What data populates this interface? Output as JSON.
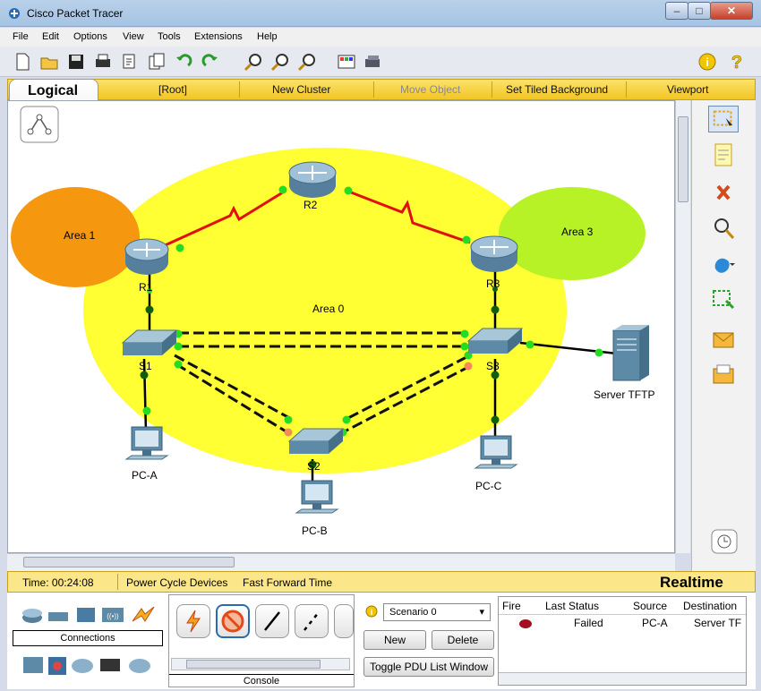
{
  "window": {
    "title": "Cisco Packet Tracer"
  },
  "menu": [
    "File",
    "Edit",
    "Options",
    "View",
    "Tools",
    "Extensions",
    "Help"
  ],
  "logical_bar": {
    "tab_label": "Logical",
    "root": "[Root]",
    "new_cluster": "New Cluster",
    "move_object": "Move Object",
    "set_tiled_background": "Set Tiled Background",
    "viewport": "Viewport"
  },
  "topology": {
    "areas": [
      "Area 0",
      "Area 1",
      "Area 3"
    ],
    "routers": [
      "R1",
      "R2",
      "R3"
    ],
    "switches": [
      "S1",
      "S2",
      "S3"
    ],
    "pcs": [
      "PC-A",
      "PC-B",
      "PC-C"
    ],
    "server": "Server TFTP"
  },
  "time_bar": {
    "time": "Time: 00:24:08",
    "power_cycle": "Power Cycle Devices",
    "fast_forward": "Fast Forward Time",
    "mode": "Realtime"
  },
  "bottom": {
    "connections_label": "Connections",
    "console_label": "Console",
    "scenario": "Scenario 0",
    "new_button": "New",
    "delete_button": "Delete",
    "toggle_button": "Toggle PDU List Window",
    "pdu_headers": [
      "Fire",
      "Last Status",
      "Source",
      "Destination"
    ],
    "pdu_row": {
      "status": "Failed",
      "source": "PC-A",
      "destination": "Server TF"
    }
  },
  "colors": {
    "area0": "#ffff33",
    "area1": "#f5970f",
    "area3": "#b6f225",
    "serial_link": "#e01010",
    "link_up": "#22dd22",
    "logical_bar": "#f7d33e"
  }
}
